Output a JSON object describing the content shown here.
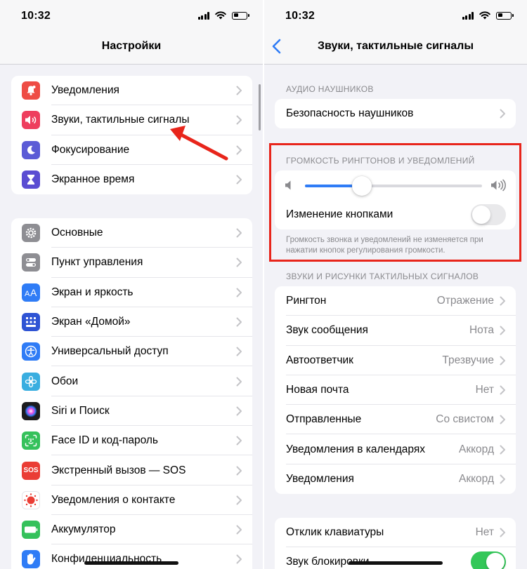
{
  "status_bar": {
    "time": "10:32"
  },
  "left": {
    "nav_title": "Настройки",
    "group1": [
      {
        "label": "Уведомления",
        "icon": "bell-icon",
        "color": "#ee4c44"
      },
      {
        "label": "Звуки, тактильные сигналы",
        "icon": "speaker-icon",
        "color": "#ee3e5e"
      },
      {
        "label": "Фокусирование",
        "icon": "moon-icon",
        "color": "#5b5bd6"
      },
      {
        "label": "Экранное время",
        "icon": "hourglass-icon",
        "color": "#5b4dd2"
      }
    ],
    "group2": [
      {
        "label": "Основные",
        "icon": "gear-icon",
        "color": "#8e8e93"
      },
      {
        "label": "Пункт управления",
        "icon": "switches-icon",
        "color": "#8e8e93"
      },
      {
        "label": "Экран и яркость",
        "icon": "text-size-icon",
        "color": "#2f7cf6"
      },
      {
        "label": "Экран «Домой»",
        "icon": "home-grid-icon",
        "color": "#2f54d4"
      },
      {
        "label": "Универсальный доступ",
        "icon": "accessibility-icon",
        "color": "#2f7cf6"
      },
      {
        "label": "Обои",
        "icon": "flower-icon",
        "color": "#3aaee0"
      },
      {
        "label": "Siri и Поиск",
        "icon": "siri-icon",
        "color": "#1c1c1e"
      },
      {
        "label": "Face ID и код-пароль",
        "icon": "face-id-icon",
        "color": "#35c15b"
      },
      {
        "label": "Экстренный вызов — SOS",
        "icon": "sos-icon",
        "color": "#ea3d35",
        "icon_text": "SOS"
      },
      {
        "label": "Уведомления о контакте",
        "icon": "exposure-icon",
        "color": "#ffffff"
      },
      {
        "label": "Аккумулятор",
        "icon": "battery-icon",
        "color": "#35c15b"
      },
      {
        "label": "Конфиденциальность",
        "icon": "hand-icon",
        "color": "#2f7cf6"
      }
    ]
  },
  "right": {
    "nav_title": "Звуки, тактильные сигналы",
    "section_headphones": "АУДИО НАУШНИКОВ",
    "headphone_safety": "Безопасность наушников",
    "section_volume": "ГРОМКОСТЬ РИНГТОНОВ И УВЕДОМЛЕНИЙ",
    "volume_level": 0.32,
    "change_with_buttons": "Изменение кнопками",
    "change_with_buttons_on": false,
    "volume_note": "Громкость звонка и уведомлений не изменяется при нажатии кнопок регулирования громкости.",
    "section_sounds": "ЗВУКИ И РИСУНКИ ТАКТИЛЬНЫХ СИГНАЛОВ",
    "sounds": [
      {
        "label": "Рингтон",
        "value": "Отражение"
      },
      {
        "label": "Звук сообщения",
        "value": "Нота"
      },
      {
        "label": "Автоответчик",
        "value": "Трезвучие"
      },
      {
        "label": "Новая почта",
        "value": "Нет"
      },
      {
        "label": "Отправленные",
        "value": "Со свистом"
      },
      {
        "label": "Уведомления в календарях",
        "value": "Аккорд"
      },
      {
        "label": "Уведомления",
        "value": "Аккорд"
      }
    ],
    "keyboard_feedback": {
      "label": "Отклик клавиатуры",
      "value": "Нет"
    },
    "lock_sound": {
      "label": "Звук блокировки",
      "on": true
    }
  },
  "colors": {
    "accent": "#2f7cf6",
    "highlight": "#e8251b",
    "toggle_on": "#34c759"
  }
}
